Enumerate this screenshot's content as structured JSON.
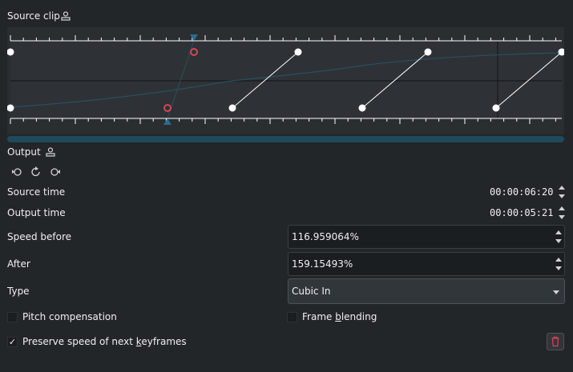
{
  "source_clip": {
    "label": "Source clip"
  },
  "output": {
    "label": "Output"
  },
  "source_time": {
    "label": "Source time",
    "value": "00:00:06:20"
  },
  "output_time": {
    "label": "Output time",
    "value": "00:00:05:21"
  },
  "speed_before": {
    "label": "Speed before",
    "value": "116.959064%"
  },
  "speed_after": {
    "label": "After",
    "value": "159.15493%"
  },
  "type": {
    "label": "Type",
    "value": "Cubic In"
  },
  "pitch": {
    "label": "Pitch compensation",
    "checked": false
  },
  "frame_blending": {
    "label_pre": "Frame ",
    "label_accel": "b",
    "label_post": "lending",
    "checked": false
  },
  "preserve": {
    "label_pre": "Preserve speed of next ",
    "label_accel": "k",
    "label_post": "eyframes",
    "checked": true,
    "check_glyph": "✓"
  },
  "colors": {
    "accent": "#1d99f3",
    "keyframe_selected": "#da4453",
    "scrollbar": "#1e4a5c"
  },
  "icons": [
    "user-profile-icon",
    "rotate-left-icon",
    "redo-icon",
    "rotate-right-icon",
    "trash-icon"
  ]
}
